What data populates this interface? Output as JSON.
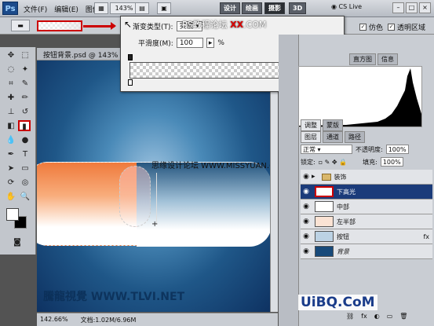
{
  "app": {
    "logo": "Ps",
    "menu": [
      "文件(F)",
      "编辑(E)",
      "图像(I)"
    ],
    "zoom_label": "143%",
    "workspace_buttons": [
      "设计",
      "绘画",
      "摄影",
      "3D"
    ],
    "cs_live": "CS Live",
    "window_buttons": [
      "–",
      "□",
      "×"
    ]
  },
  "options_bar": {
    "checks": [
      {
        "label": "仿色",
        "checked": true
      },
      {
        "label": "透明区域",
        "checked": true
      }
    ]
  },
  "document": {
    "tab_title": "按钮背景.psd @ 143% (下...",
    "zoom": "142.66%",
    "doc_size": "文档:1.02M/6.96M"
  },
  "canvas": {
    "watermark_mid": "思缘设计论坛 WWW.MISSYUAN.COM",
    "watermark_bottom": "騰龍視覺 WWW.TLVI.NET"
  },
  "gradient_editor": {
    "type_label": "渐变类型(T):",
    "type_value": "实底",
    "smoothness_label": "平滑度(M):",
    "smoothness_value": "100",
    "smoothness_unit": "%",
    "watermark": "PS教程论坛",
    "watermark_red": "XX",
    "watermark_domain": ".COM"
  },
  "panels": {
    "histogram_tabs": [
      "直方图",
      "信息"
    ],
    "adjust_tabs": [
      "调整",
      "蒙版"
    ],
    "layer_tabs": [
      "图层",
      "通道",
      "路径"
    ],
    "blend_mode": "正常",
    "opacity_label": "不透明度:",
    "opacity_value": "100%",
    "lock_label": "锁定:",
    "fill_label": "填充:",
    "fill_value": "100%",
    "layers": [
      {
        "name": "装饰",
        "type": "group",
        "active": false
      },
      {
        "name": "下高光",
        "type": "layer",
        "active": true
      },
      {
        "name": "中部",
        "type": "layer",
        "active": false
      },
      {
        "name": "左半部",
        "type": "layer",
        "active": false
      },
      {
        "name": "按钮",
        "type": "layer",
        "active": false,
        "fx": "fx"
      },
      {
        "name": "背景",
        "type": "layer",
        "active": false
      }
    ]
  },
  "watermark_logo": "UiBQ.CoM"
}
